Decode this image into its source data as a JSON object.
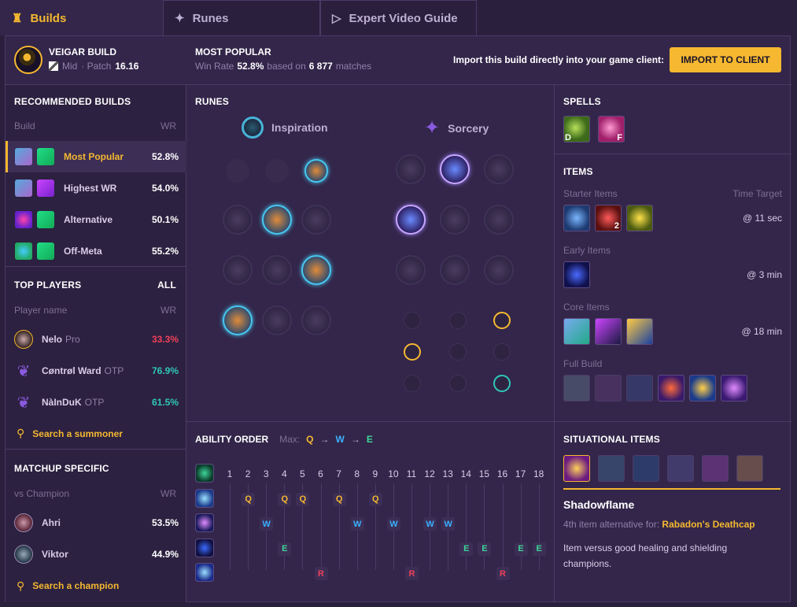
{
  "tabs": [
    {
      "label": "Builds",
      "icon": "builds-icon",
      "active": true
    },
    {
      "label": "Runes",
      "icon": "runes-icon",
      "active": false
    },
    {
      "label": "Expert Video Guide",
      "icon": "video-icon",
      "active": false
    }
  ],
  "header": {
    "build_title": "VEIGAR BUILD",
    "role": "Mid",
    "patch_prefix": "· Patch",
    "patch": "16.16",
    "popular_title": "MOST POPULAR",
    "wr_label": "Win Rate",
    "wr_value": "52.8%",
    "based_on": "based on",
    "matches_value": "6 877",
    "matches_label": "matches",
    "import_text": "Import this build directly into your game client:",
    "import_button": "IMPORT TO CLIENT"
  },
  "recommended": {
    "title": "RECOMMENDED BUILDS",
    "col_build": "Build",
    "col_wr": "WR",
    "rows": [
      {
        "label": "Most Popular",
        "wr": "52.8%"
      },
      {
        "label": "Highest WR",
        "wr": "54.0%"
      },
      {
        "label": "Alternative",
        "wr": "50.1%"
      },
      {
        "label": "Off-Meta",
        "wr": "55.2%"
      }
    ]
  },
  "top_players": {
    "title": "TOP PLAYERS",
    "all": "ALL",
    "col_name": "Player name",
    "col_wr": "WR",
    "rows": [
      {
        "name": "Nelo",
        "tag": "Pro",
        "wr": "33.3%",
        "color": "#f0405a"
      },
      {
        "name": "Cøntrøl Ward",
        "tag": "OTP",
        "wr": "76.9%",
        "color": "#2fc7b8"
      },
      {
        "name": "NàInDuK",
        "tag": "OTP",
        "wr": "61.5%",
        "color": "#2fc7b8"
      }
    ],
    "search": "Search a summoner"
  },
  "matchup": {
    "title": "MATCHUP SPECIFIC",
    "col_name": "vs Champion",
    "col_wr": "WR",
    "rows": [
      {
        "name": "Ahri",
        "wr": "53.5%"
      },
      {
        "name": "Viktor",
        "wr": "44.9%"
      }
    ],
    "search": "Search a champion"
  },
  "runes": {
    "title": "RUNES",
    "primary": "Inspiration",
    "secondary": "Sorcery"
  },
  "ability": {
    "title": "ABILITY ORDER",
    "max_label": "Max:",
    "order": [
      "Q",
      "W",
      "E"
    ],
    "levels": [
      "1",
      "2",
      "3",
      "4",
      "5",
      "6",
      "7",
      "8",
      "9",
      "10",
      "11",
      "12",
      "13",
      "14",
      "15",
      "16",
      "17",
      "18"
    ],
    "q": [
      2,
      4,
      5,
      7,
      9
    ],
    "w": [
      3,
      8,
      10,
      12,
      13
    ],
    "e": [
      4,
      14,
      15,
      17,
      18
    ],
    "r": [
      6,
      11,
      16
    ]
  },
  "spells": {
    "title": "SPELLS",
    "keys": [
      "D",
      "F"
    ]
  },
  "items": {
    "title": "ITEMS",
    "starter": "Starter Items",
    "time_target": "Time Target",
    "starter_time": "@ 11 sec",
    "starter_count": "2",
    "early": "Early Items",
    "early_time": "@ 3 min",
    "core": "Core Items",
    "core_time": "@ 18 min",
    "full": "Full Build"
  },
  "situational": {
    "title": "SITUATIONAL ITEMS",
    "item_name": "Shadowflame",
    "alt_prefix": "4th item alternative for:",
    "alt_item": "Rabadon's Deathcap",
    "desc": "Item versus good healing and shielding champions."
  },
  "colors": {
    "accent": "#f5b830",
    "q": "#f5b830",
    "w": "#3ab0ff",
    "e": "#3ed598",
    "r": "#f0405a"
  }
}
